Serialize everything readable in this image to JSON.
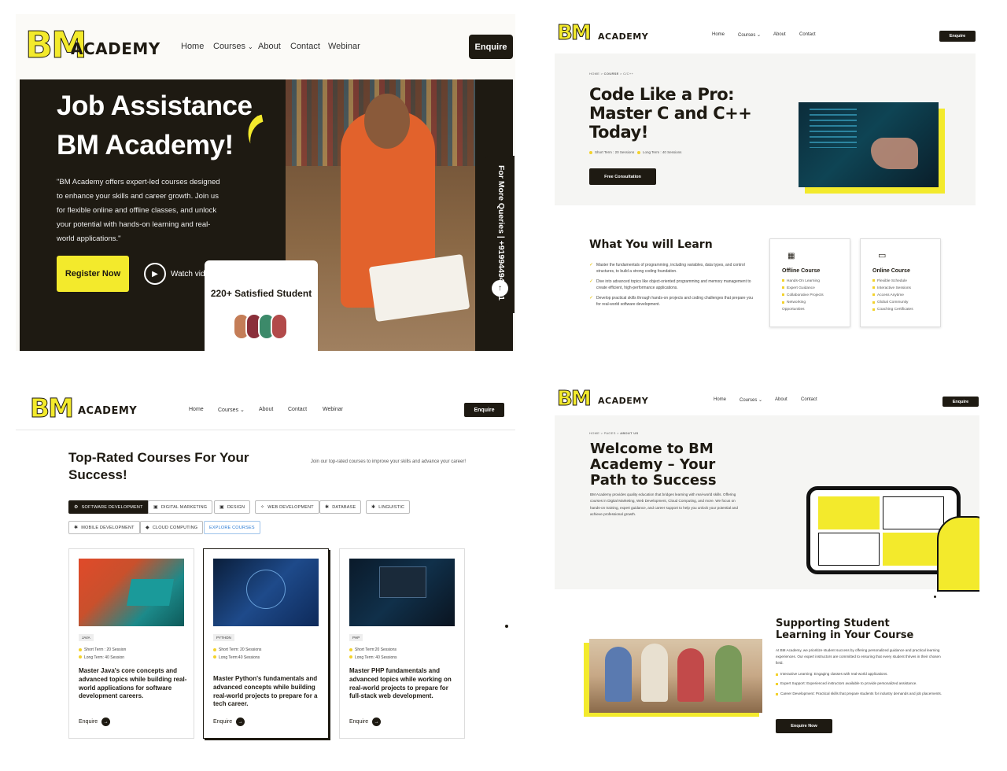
{
  "nav_common": {
    "logo_mark": "BM",
    "logo_text": "ACADEMY",
    "home": "Home",
    "courses": "Courses",
    "about": "About",
    "contact": "Contact",
    "webinar": "Webinar",
    "enquire": "Enquire",
    "chevron": "⌄"
  },
  "panel1": {
    "title_line1": "Job Assistance",
    "title_line2": "BM Academy!",
    "description": "\"BM Academy offers expert-led courses designed to enhance your skills and career growth. Join us for flexible online and offline classes, and unlock your potential with hands-on learning and real-world applications.\"",
    "register_label": "Register Now",
    "watch_label": "Watch video",
    "satisfied_label": "220+ Satisfied Student",
    "side_tab": "For More Queries | +919944940051"
  },
  "panel2": {
    "breadcrumb": [
      "HOME",
      "COURSE",
      "C/C++"
    ],
    "title_line1": "Code Like a Pro:",
    "title_line2": "Master C and C++",
    "title_line3": "Today!",
    "short_term": "Short Term : 20 Sessions",
    "long_term": "Long Term : 40 Sessions",
    "consult_label": "Free Consultation",
    "learn_heading": "What You will Learn",
    "learn_items": [
      "Master the fundamentals of programming, including variables, data types, and control structures, to build a strong coding foundation.",
      "Dive into advanced topics like object-oriented programming and memory management to create efficient, high-performance applications.",
      "Develop practical skills through hands-on projects and coding challenges that prepare you for real-world software development."
    ],
    "offline_title": "Offline Course",
    "offline_items": [
      "Hands-On Learning",
      "Expert Guidance",
      "Collaborative Projects",
      "Networking Opportunities"
    ],
    "online_title": "Online Course",
    "online_items": [
      "Flexible Schedule",
      "Interactive Sessions",
      "Access Anytime",
      "Global Community",
      "Coaching Certificates"
    ]
  },
  "panel3": {
    "heading_line1": "Top-Rated Courses For Your",
    "heading_line2": "Success!",
    "subtext": "Join our top-rated courses to improve your skills and advance your career!",
    "chips": [
      {
        "label": "SOFTWARE DEVELOPMENT",
        "icon": "⚙"
      },
      {
        "label": "DIGITAL MARKETING",
        "icon": "▣"
      },
      {
        "label": "DESIGN",
        "icon": "▣"
      },
      {
        "label": "WEB DEVELOPMENT",
        "icon": "✧"
      },
      {
        "label": "DATABASE",
        "icon": "✱"
      },
      {
        "label": "LINGUISTIC",
        "icon": "✱"
      },
      {
        "label": "MOBILE DEVELOPMENT",
        "icon": "✱"
      },
      {
        "label": "CLOUD COMPUTING",
        "icon": "◆"
      },
      {
        "label": "EXPLORE COURSES",
        "icon": ""
      }
    ],
    "cards": [
      {
        "tag": "JAVA",
        "short": "Short Term : 20 Session",
        "long": "Long Term: 40 Session",
        "desc": "Master Java's core concepts and advanced topics while building real-world applications for software development careers.",
        "enquire": "Enquire"
      },
      {
        "tag": "PYTHON",
        "short": "Short Term: 20 Sessions",
        "long": "Long Term:40 Sessions",
        "desc": "Master Python's fundamentals and advanced concepts while building real-world projects to prepare for a tech career.",
        "enquire": "Enquire"
      },
      {
        "tag": "PHP",
        "short": "Short Term:20 Sessions",
        "long": "Long Term: 40 Sessions",
        "desc": "Master PHP fundamentals and advanced topics while working on real-world projects to prepare for full-stack web development.",
        "enquire": "Enquire"
      }
    ]
  },
  "panel4": {
    "breadcrumb": [
      "HOME",
      "PAGES",
      "ABOUT US"
    ],
    "title_line1": "Welcome to BM",
    "title_line2": "Academy – Your",
    "title_line3": "Path to Success",
    "description": "BM Academy provides quality education that bridges learning with real-world skills. Offering courses in Digital Marketing, Web Development, Cloud Computing, and more. We focus on hands-on training, expert guidance, and career support to help you unlock your potential and achieve professional growth.",
    "support_line1": "Supporting Student",
    "support_line2": "Learning in Your Course",
    "support_text": "At BM Academy, we prioritize student success by offering personalized guidance and practical learning experiences. Our expert instructors are committed to ensuring that every student thrives in their chosen field.",
    "support_items": [
      "Interactive Learning: Engaging classes with real-world applications.",
      "Expert Support: Experienced instructors available to provide personalized assistance.",
      "Career Development: Practical skills that prepare students for industry demands and job placements."
    ],
    "enquire_now": "Enquire Now"
  },
  "colors": {
    "accent_yellow": "#f3ea2c",
    "dark": "#1e1a12"
  }
}
